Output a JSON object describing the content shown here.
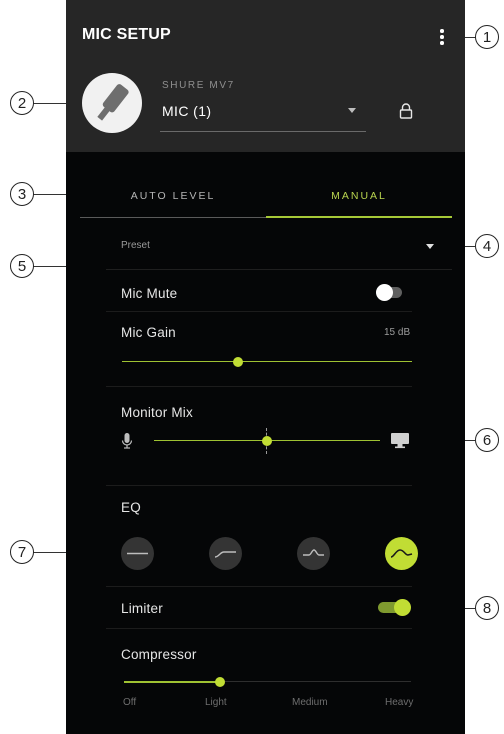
{
  "header": {
    "title": "MIC SETUP",
    "device_name": "SHURE MV7",
    "mic_select_value": "MIC (1)"
  },
  "tabs": [
    {
      "label": "AUTO LEVEL",
      "active": false
    },
    {
      "label": "MANUAL",
      "active": true
    }
  ],
  "preset": {
    "label": "Preset"
  },
  "mic_mute": {
    "label": "Mic Mute",
    "on": false
  },
  "mic_gain": {
    "label": "Mic Gain",
    "value_text": "15 dB",
    "level": 0.4
  },
  "monitor_mix": {
    "label": "Monitor Mix",
    "level": 0.5,
    "left_icon": "microphone-icon",
    "right_icon": "monitor-icon"
  },
  "eq": {
    "label": "EQ",
    "options": [
      "flat-eq-icon",
      "high-pass-eq-icon",
      "presence-eq-icon",
      "bass-cut-eq-icon"
    ],
    "selected_index": 3
  },
  "limiter": {
    "label": "Limiter",
    "on": true
  },
  "compressor": {
    "label": "Compressor",
    "levels": [
      "Off",
      "Light",
      "Medium",
      "Heavy"
    ],
    "selected_index": 1
  },
  "callouts": [
    "1",
    "2",
    "3",
    "4",
    "5",
    "6",
    "7",
    "8"
  ],
  "colors": {
    "accent": "#c1dd34",
    "accent_dark": "#9fc232",
    "header_bg": "#262626",
    "body_bg": "#050607"
  }
}
